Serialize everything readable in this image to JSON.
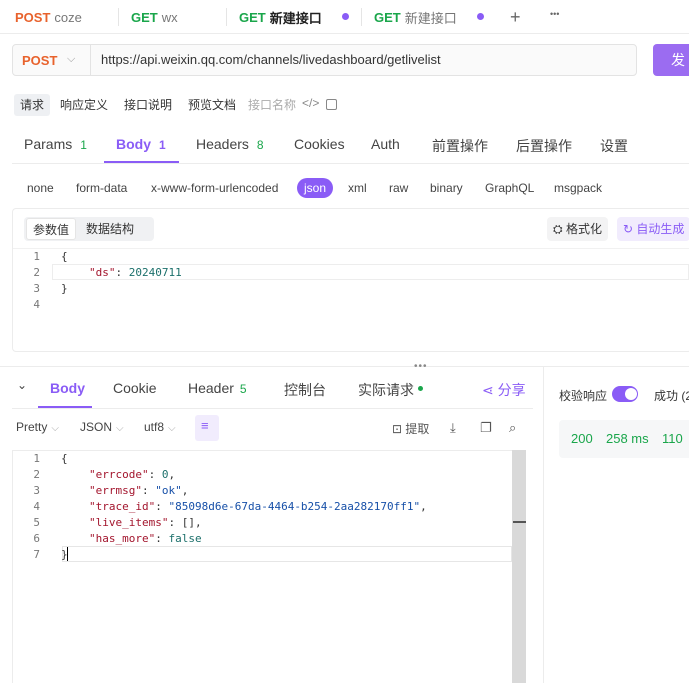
{
  "tabs": [
    {
      "method": "POST",
      "title": "coze"
    },
    {
      "method": "GET",
      "title": "wx"
    },
    {
      "method": "GET",
      "title": "新建接口"
    },
    {
      "method": "GET",
      "title": "新建接口"
    }
  ],
  "tab_actions": {
    "add": "+",
    "more": "•••"
  },
  "request": {
    "method": "POST",
    "url": "https://api.weixin.qq.com/channels/livedashboard/getlivelist",
    "send_label": "发"
  },
  "subtabs": [
    "请求",
    "响应定义",
    "接口说明",
    "预览文档"
  ],
  "subtab_placeholder": "接口名称",
  "main_tabs": [
    {
      "label": "Params",
      "count": "1"
    },
    {
      "label": "Body",
      "count": "1"
    },
    {
      "label": "Headers",
      "count": "8"
    },
    {
      "label": "Cookies",
      "count": ""
    },
    {
      "label": "Auth",
      "count": ""
    },
    {
      "label": "前置操作",
      "count": ""
    },
    {
      "label": "后置操作",
      "count": ""
    },
    {
      "label": "设置",
      "count": ""
    }
  ],
  "body_types": [
    "none",
    "form-data",
    "x-www-form-urlencoded",
    "json",
    "xml",
    "raw",
    "binary",
    "GraphQL",
    "msgpack"
  ],
  "editor_modes": [
    "参数值",
    "数据结构"
  ],
  "editor_actions": {
    "format": "格式化",
    "auto": "自动生成"
  },
  "request_body": {
    "line_numbers": [
      "1",
      "2",
      "3",
      "4"
    ],
    "open": "{",
    "key": "\"ds\"",
    "colon": ": ",
    "value": "20240711",
    "close": "}"
  },
  "splitter": "•••",
  "response_tabs": [
    {
      "label": "Body",
      "count": ""
    },
    {
      "label": "Cookie",
      "count": ""
    },
    {
      "label": "Header",
      "count": "5"
    },
    {
      "label": "控制台",
      "count": ""
    },
    {
      "label": "实际请求",
      "count": ""
    }
  ],
  "response_share": "分享",
  "response_toolbar": {
    "view": "Pretty",
    "format": "JSON",
    "encoding": "utf8",
    "extract": "提取"
  },
  "response_body": {
    "line_numbers": [
      "1",
      "2",
      "3",
      "4",
      "5",
      "6",
      "7"
    ],
    "open": "{",
    "fields": [
      {
        "key": "\"errcode\"",
        "value": "0",
        "sep": ","
      },
      {
        "key": "\"errmsg\"",
        "value": "\"ok\"",
        "sep": ","
      },
      {
        "key": "\"trace_id\"",
        "value": "\"85098d6e-67da-4464-b254-2aa282170ff1\"",
        "sep": ","
      },
      {
        "key": "\"live_items\"",
        "value": "[]",
        "sep": ","
      },
      {
        "key": "\"has_more\"",
        "value": "false",
        "sep": ""
      }
    ],
    "close": "}"
  },
  "validation": {
    "label": "校验响应",
    "enabled": true,
    "result": "成功 (2"
  },
  "stats": {
    "status": "200",
    "time": "258 ms",
    "size": "110"
  },
  "colors": {
    "accent": "#8a5cf6",
    "get": "#1aa64b",
    "post": "#e8622c"
  }
}
